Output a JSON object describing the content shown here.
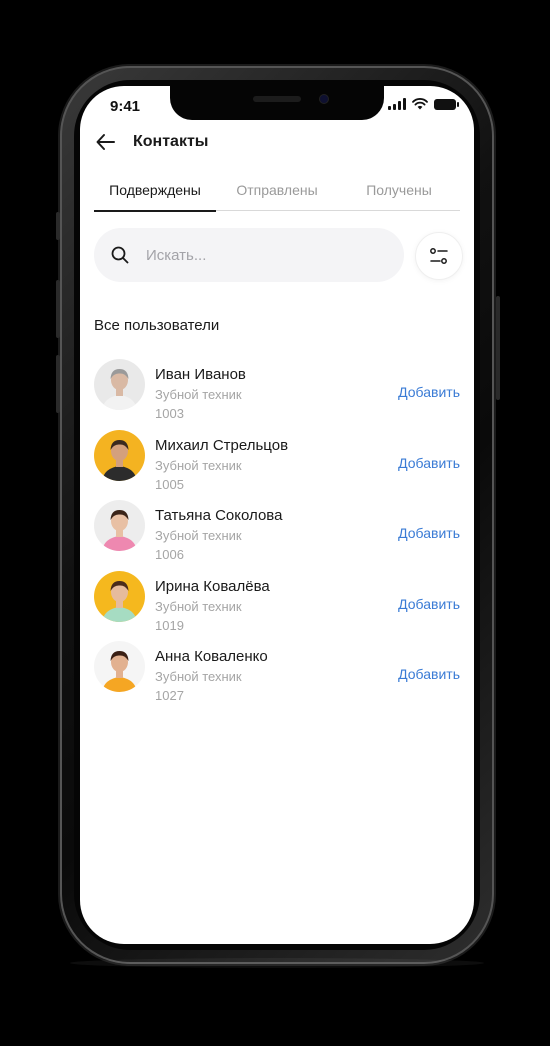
{
  "status_bar": {
    "time": "9:41"
  },
  "header": {
    "title": "Контакты",
    "back_icon": "arrow-left-icon"
  },
  "tabs": [
    {
      "label": "Подверждены",
      "active": true
    },
    {
      "label": "Отправлены",
      "active": false
    },
    {
      "label": "Получены",
      "active": false
    }
  ],
  "search": {
    "placeholder": "Искать...",
    "value": "",
    "icon": "search-icon"
  },
  "filter": {
    "icon": "filter-sliders-icon"
  },
  "section": {
    "title": "Все пользователи"
  },
  "contacts": [
    {
      "name": "Иван Иванов",
      "role": "Зубной техник",
      "id": "1003",
      "action": "Добавить",
      "avatar_bg": "#e9e9e9",
      "shirt": "#f2f2f2",
      "skin": "#d9b9a4",
      "hair": "#9a9a9a"
    },
    {
      "name": "Михаил Стрельцов",
      "role": "Зубной техник",
      "id": "1005",
      "action": "Добавить",
      "avatar_bg": "#f4b321",
      "shirt": "#2c2c2c",
      "skin": "#d4a07d",
      "hair": "#3b2a1f"
    },
    {
      "name": "Татьяна Соколова",
      "role": "Зубной техник",
      "id": "1006",
      "action": "Добавить",
      "avatar_bg": "#ededed",
      "shirt": "#ee88b0",
      "skin": "#e8c0a4",
      "hair": "#3a2418"
    },
    {
      "name": "Ирина Ковалёва",
      "role": "Зубной техник",
      "id": "1019",
      "action": "Добавить",
      "avatar_bg": "#f5b81e",
      "shirt": "#a6dcc2",
      "skin": "#e6bb9c",
      "hair": "#4a2c1b"
    },
    {
      "name": "Анна Коваленко",
      "role": "Зубной техник",
      "id": "1027",
      "action": "Добавить",
      "avatar_bg": "#f5f5f5",
      "shirt": "#f5a623",
      "skin": "#e2b190",
      "hair": "#3a1f14"
    }
  ],
  "colors": {
    "accent": "#3a7bd5",
    "muted": "#a5a5a5",
    "search_bg": "#f4f4f6"
  }
}
